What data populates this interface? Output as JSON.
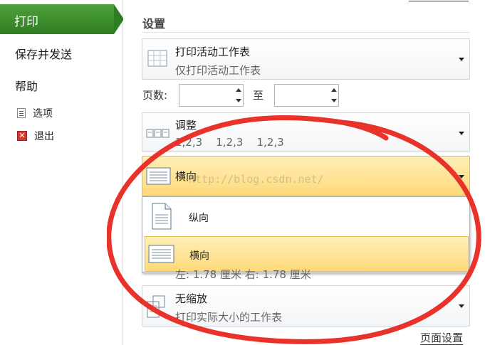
{
  "nav": {
    "print": "打印",
    "save_send": "保存并发送",
    "help": "帮助",
    "options": "选项",
    "exit": "退出"
  },
  "settings": {
    "heading": "设置",
    "print_what": {
      "title": "打印活动工作表",
      "subtitle": "仅打印活动工作表"
    },
    "pages": {
      "label": "页数:",
      "to": "至",
      "from_value": "",
      "to_value": ""
    },
    "collate": {
      "title": "调整",
      "subtitle": "1,2,3    1,2,3    1,2,3"
    },
    "orientation": {
      "selected": "横向",
      "options": [
        {
          "label": "纵向"
        },
        {
          "label": "横向"
        }
      ]
    },
    "margins_peek": "左: 1.78 厘米    右: 1.78 厘米",
    "scaling": {
      "title": "无缩放",
      "subtitle": "打印实际大小的工作表"
    },
    "page_setup": "页面设置"
  },
  "watermark": "http://blog.csdn.net/",
  "colors": {
    "nav_green": "#2e7d23",
    "selected_fill": "#ffd97a",
    "annotation_red": "#e8322a"
  }
}
